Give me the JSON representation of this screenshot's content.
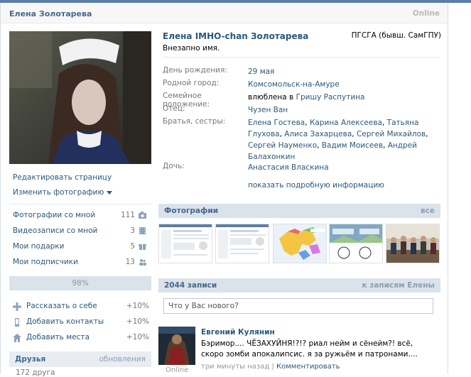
{
  "header": {
    "name": "Елена Золотарева",
    "online": "Online"
  },
  "left": {
    "actions": {
      "edit": "Редактировать страницу",
      "change_photo": "Изменить фотографию"
    },
    "stats": [
      {
        "label": "Фотографии со мной",
        "count": "111",
        "icon": "camera-icon"
      },
      {
        "label": "Видеозаписи со мной",
        "count": "3",
        "icon": "film-icon"
      },
      {
        "label": "Мои подарки",
        "count": "5",
        "icon": "gift-icon"
      },
      {
        "label": "Мои подписчики",
        "count": "13",
        "icon": "people-icon"
      }
    ],
    "completeness": {
      "text": "98%",
      "value": 98
    },
    "tips": [
      {
        "label": "Рассказать о себе",
        "pct": "+10%",
        "icon": "plus-icon"
      },
      {
        "label": "Добавить контакты",
        "pct": "+10%",
        "icon": "phone-icon"
      },
      {
        "label": "Добавить места",
        "pct": "+10%",
        "icon": "house-icon"
      }
    ],
    "friends": {
      "title": "Друзья",
      "updates": "обновления",
      "count": "172 друга"
    }
  },
  "profile": {
    "full_name": "Елена IMHO-chan Золотарева",
    "university": "ПГСГА (бывш. СамГПУ)",
    "status": "Внезапно имя.",
    "birthday": {
      "label": "День рождения:",
      "value": "29 мая"
    },
    "hometown": {
      "label": "Родной город:",
      "value": "Комсомольск-на-Амуре"
    },
    "relationship": {
      "label": "Семейное положение:",
      "prefix": "влюблена в",
      "person": "Гришу Распутина"
    },
    "father": {
      "label": "Отец:",
      "value": "Чузен Ван"
    },
    "siblings": {
      "label": "Братья, сестры:",
      "names": [
        "Елена Гостева",
        "Карина Алексеева",
        "Татьяна Глухова",
        "Алиса Захарцева",
        "Сергей Михайлов",
        "Сергей Науменко",
        "Вадим Моисеев",
        "Андрей Балахонкин"
      ]
    },
    "daughter": {
      "label": "Дочь:",
      "value": "Анастасия Власкина"
    },
    "show_more": "показать подробную информацию"
  },
  "photos": {
    "title": "Фотографии",
    "all": "все"
  },
  "wall": {
    "count": "2044 записи",
    "link": "к записям Елены",
    "placeholder": "Что у Вас нового?",
    "post": {
      "author": "Евгений Кулянин",
      "text": "Бэримор.... ЧЁЗАХУЙНЯ!?!? риал нейм и сёнейм?! всё, скоро зомби апокалипсис. я за ружьём и патронами....",
      "time": "три минуты назад",
      "comment": "Комментировать",
      "avatar_status": "Online"
    }
  }
}
